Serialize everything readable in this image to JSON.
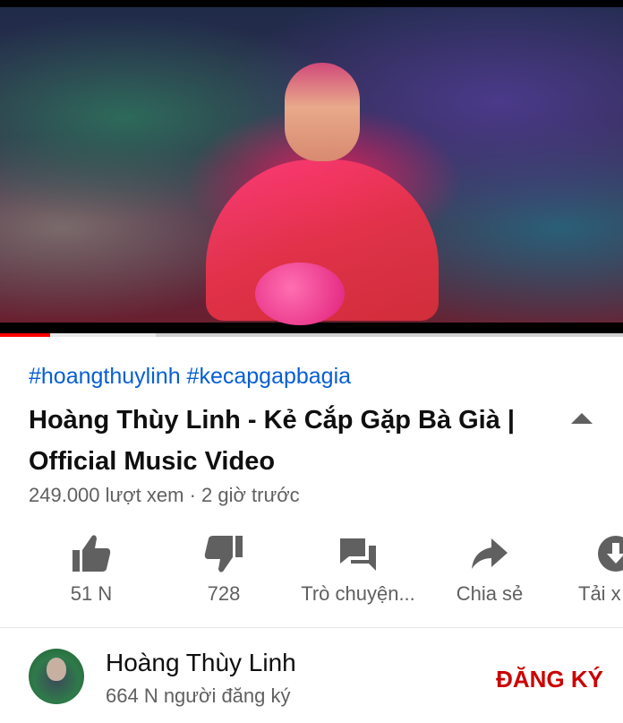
{
  "player": {
    "progress_fraction": 0.08,
    "buffer_fraction": 0.25
  },
  "hashtags": [
    "#hoangthuylinh",
    "#kecapgapbagia"
  ],
  "video": {
    "title": "Hoàng Thùy Linh - Kẻ Cắp Gặp Bà Già | Official Music Video",
    "meta": "249.000 lượt xem · 2 giờ trước"
  },
  "actions": [
    {
      "icon": "thumbs-up-icon",
      "label": "51 N"
    },
    {
      "icon": "thumbs-down-icon",
      "label": "728"
    },
    {
      "icon": "chat-icon",
      "label": "Trò chuyện..."
    },
    {
      "icon": "share-icon",
      "label": "Chia sẻ"
    },
    {
      "icon": "download-icon",
      "label": "Tải x"
    }
  ],
  "channel": {
    "name": "Hoàng Thùy Linh",
    "subscribers": "664 N người đăng ký",
    "subscribe_label": "ĐĂNG KÝ"
  },
  "colors": {
    "accent_red": "#cc0000",
    "progress_red": "#ff0000",
    "hashtag_blue": "#065fd4",
    "secondary_text": "#606060"
  }
}
